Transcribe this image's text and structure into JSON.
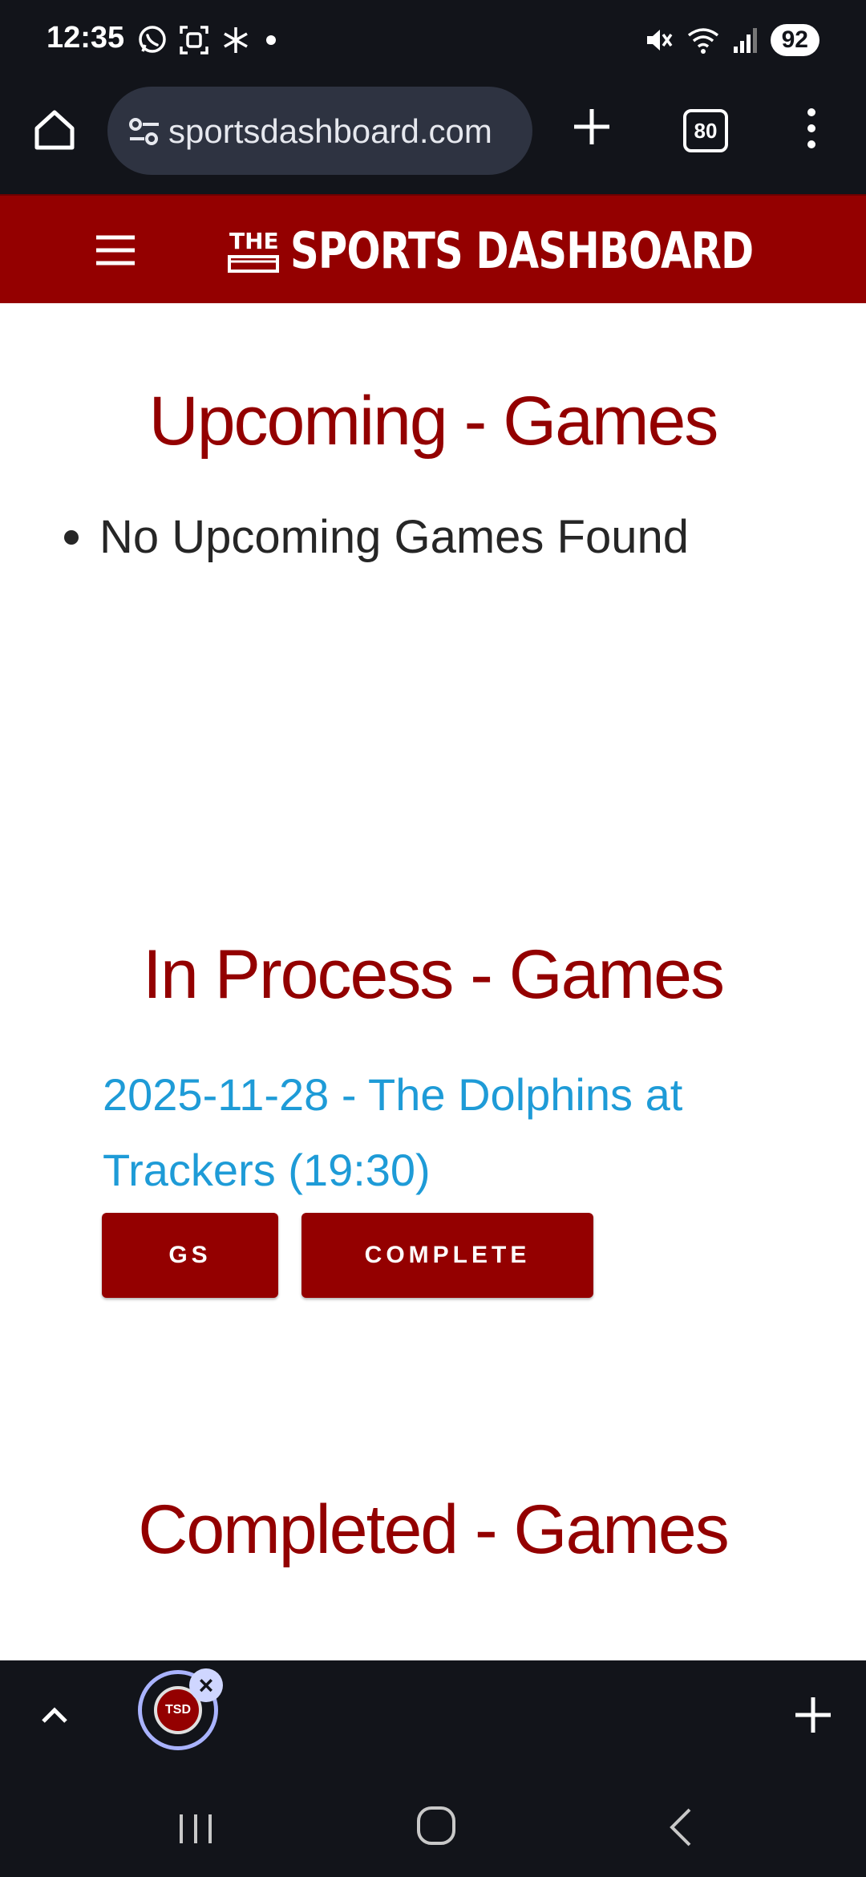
{
  "status_bar": {
    "time": "12:35",
    "left_icons": [
      "whatsapp-icon",
      "screenshot-icon",
      "snowflake-icon",
      "dot-icon"
    ],
    "right_icons": [
      "mute-icon",
      "wifi-icon",
      "signal-icon"
    ],
    "battery": "92"
  },
  "browser": {
    "url": "sportsdashboard.com",
    "tab_count": "80"
  },
  "site": {
    "logo_the": "THE",
    "logo_text": "SPORTS DASHBOARD",
    "brand_color": "#940000"
  },
  "upcoming": {
    "title": "Upcoming - Games",
    "empty_message": "No Upcoming Games Found"
  },
  "in_process": {
    "title": "In Process - Games",
    "game_link": "2025-11-28 - The Dolphins at Trackers (19:30)",
    "gs_button": "GS",
    "complete_button": "COMPLETE"
  },
  "completed": {
    "title": "Completed - Games"
  },
  "bottom_toolbar": {
    "tab_badge": "TSD"
  },
  "colors": {
    "heading": "#930000",
    "link": "#1e9bd7",
    "chrome_dark": "#12141a"
  }
}
